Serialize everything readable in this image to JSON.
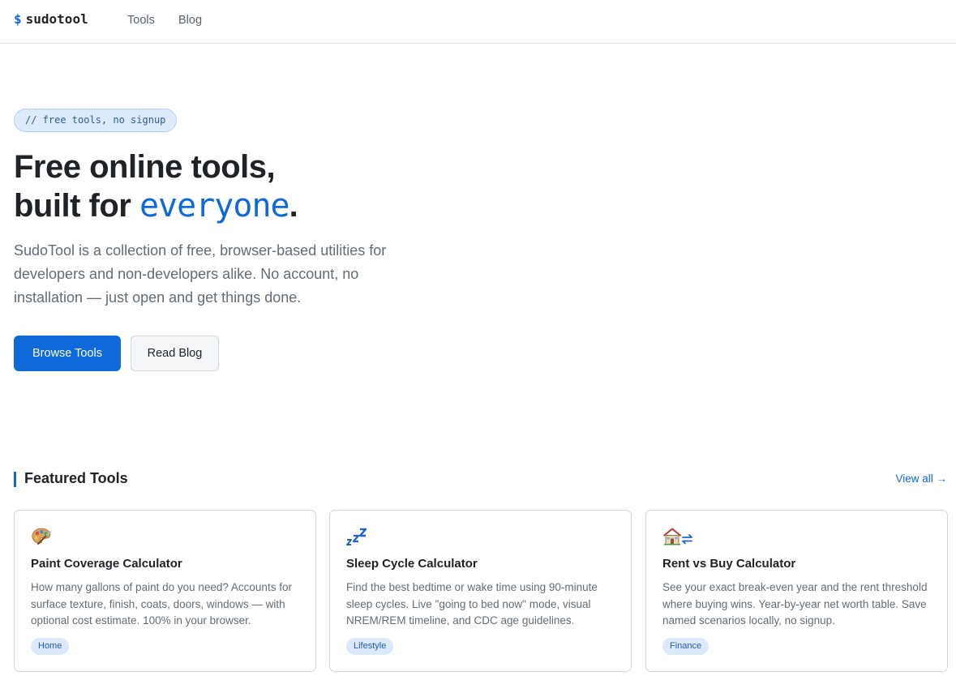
{
  "nav": {
    "logo_symbol": "$",
    "logo_text": "sudotool",
    "links": [
      {
        "label": "Tools"
      },
      {
        "label": "Blog"
      }
    ]
  },
  "hero": {
    "pill": "// free tools, no signup",
    "title_line1": "Free online tools,",
    "title_line2_prefix": "built for ",
    "title_line2_accent": "everyone",
    "title_line2_suffix": ".",
    "description": "SudoTool is a collection of free, browser-based utilities for developers and non-developers alike. No account, no installation — just open and get things done.",
    "primary_button": "Browse Tools",
    "secondary_button": "Read Blog"
  },
  "featured": {
    "title": "Featured Tools",
    "view_all": "View all →",
    "cards": [
      {
        "icon": "paint-palette-icon",
        "title": "Paint Coverage Calculator",
        "description": "How many gallons of paint do you need? Accounts for surface texture, finish, coats, doors, windows — with optional cost estimate. 100% in your browser.",
        "tag": "Home"
      },
      {
        "icon": "zzz-sleep-icon",
        "title": "Sleep Cycle Calculator",
        "description": "Find the best bedtime or wake time using 90-minute sleep cycles. Live \"going to bed now\" mode, visual NREM/REM timeline, and CDC age guidelines.",
        "tag": "Lifestyle"
      },
      {
        "icon": "house-exchange-icon",
        "title": "Rent vs Buy Calculator",
        "description": "See your exact break-even year and the rent threshold where buying wins. Year-by-year net worth table. Save named scenarios locally, no signup.",
        "tag": "Finance"
      }
    ]
  },
  "colors": {
    "accent": "#0f69d9",
    "tag_bg": "#dbe9fb",
    "pill_bg": "#ddeafb"
  }
}
